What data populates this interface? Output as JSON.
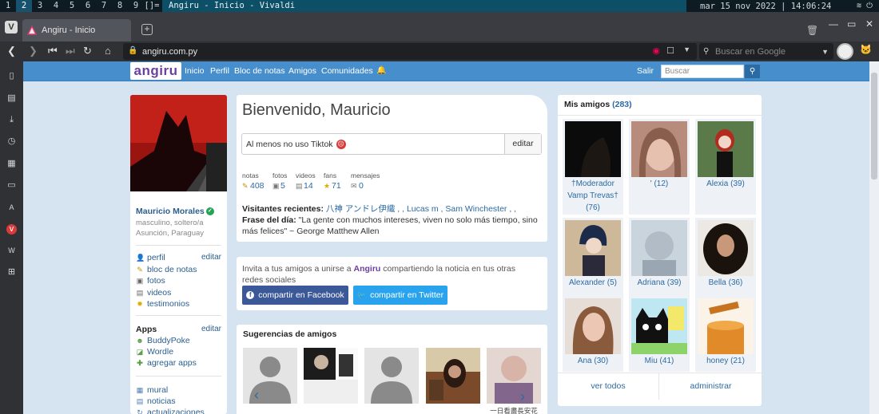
{
  "os": {
    "workspaces": [
      "1",
      "2",
      "3",
      "4",
      "5",
      "6",
      "7",
      "8",
      "9",
      "[]="
    ],
    "active_workspace": "2",
    "window_title": "Angiru - Inicio - Vivaldi",
    "datetime": "mar 15 nov 2022 | 14:06:24"
  },
  "browser": {
    "tab_title": "Angiru - Inicio",
    "url": "angiru.com.py",
    "search_placeholder": "Buscar en Google"
  },
  "site": {
    "logo": "angiru",
    "nav": [
      "Inicio",
      "Perfil",
      "Bloc de notas",
      "Amigos",
      "Comunidades"
    ],
    "logout": "Salir",
    "search_placeholder": "Buscar"
  },
  "profile": {
    "name": "Mauricio Morales",
    "line1": "masculino, soltero/a",
    "line2": "Asunción, Paraguay",
    "links": [
      {
        "label": "perfil",
        "icon": "person-icon"
      },
      {
        "label": "bloc de notas",
        "icon": "notepad-icon"
      },
      {
        "label": "fotos",
        "icon": "photo-icon"
      },
      {
        "label": "videos",
        "icon": "film-icon"
      },
      {
        "label": "testimonios",
        "icon": "star-icon"
      }
    ],
    "edit_label": "editar",
    "apps_title": "Apps",
    "apps_edit": "editar",
    "apps": [
      {
        "label": "BuddyPoke"
      },
      {
        "label": "Wordle"
      },
      {
        "label": "agregar apps"
      }
    ],
    "bottom_links": [
      {
        "label": "mural"
      },
      {
        "label": "noticias"
      },
      {
        "label": "actualizaciones"
      }
    ]
  },
  "welcome": {
    "title": "Bienvenido, Mauricio",
    "status": "Al menos no uso Tiktok",
    "edit": "editar",
    "stats": [
      {
        "label": "notas",
        "value": "408"
      },
      {
        "label": "fotos",
        "value": "5"
      },
      {
        "label": "videos",
        "value": "14"
      },
      {
        "label": "fans",
        "value": "71"
      },
      {
        "label": "mensajes",
        "value": "0"
      }
    ],
    "visitors_label": "Visitantes recientes:",
    "visitors": "八神 アンドレ伊織 ,                  , Lucas m , Sam Winchester , ,",
    "phrase_label": "Frase del día:",
    "phrase": "\"La gente con muchos intereses, viven no solo más tiempo, sino más felices\" ~ George Matthew Allen"
  },
  "invite": {
    "text_before": "Invita a tus amigos a unirse a",
    "brand": "Angiru",
    "text_after": "compartiendo la noticia en tus otras redes sociales",
    "facebook": "compartir en Facebook",
    "twitter": "compartir en Twitter",
    "facebook_color": "#3b5998",
    "twitter_color": "#2aa3ef"
  },
  "suggestions": {
    "title": "Sugerencias de amigos",
    "names": [
      "",
      "",
      "",
      "",
      "一日看盡長安花"
    ]
  },
  "friends": {
    "title": "Mis amigos",
    "count": "(283)",
    "list": [
      {
        "name": "†Moderador Vamp Trevas† (76)"
      },
      {
        "name": "' (12)"
      },
      {
        "name": "Alexia (39)"
      },
      {
        "name": "Alexander (5)"
      },
      {
        "name": "Adriana (39)"
      },
      {
        "name": "Bella (36)"
      },
      {
        "name": "Ana (30)"
      },
      {
        "name": "Miu (41)"
      },
      {
        "name": "honey (21)"
      }
    ],
    "view_all": "ver todos",
    "admin": "administrar"
  },
  "colors": {
    "nav_blue": "#478fcc",
    "page_bg": "#d6e3f1",
    "brand_purple": "#6b3fa0",
    "link_blue": "#2b6aa3"
  }
}
